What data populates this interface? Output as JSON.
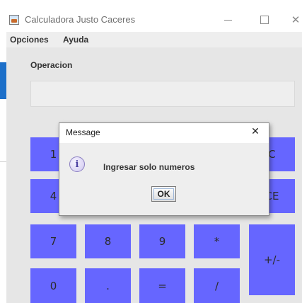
{
  "window": {
    "title": "Calculadora Justo Caceres",
    "icon": "java-cup-icon",
    "controls": {
      "minimize": "minimize-icon",
      "maximize": "maximize-icon",
      "close": "✕"
    }
  },
  "menubar": {
    "items": [
      "Opciones",
      "Ayuda"
    ]
  },
  "operation": {
    "label": "Operacion",
    "value": ""
  },
  "keypad": {
    "color": "#6666ff",
    "keys": [
      "1",
      "C",
      "4",
      "CE",
      "7",
      "8",
      "9",
      "*",
      "+/-",
      "0",
      ".",
      "=",
      "/"
    ]
  },
  "dialog": {
    "title": "Message",
    "close": "✕",
    "icon": "info-icon",
    "icon_glyph": "i",
    "message": "Ingresar solo numeros",
    "ok_label": "OK"
  }
}
